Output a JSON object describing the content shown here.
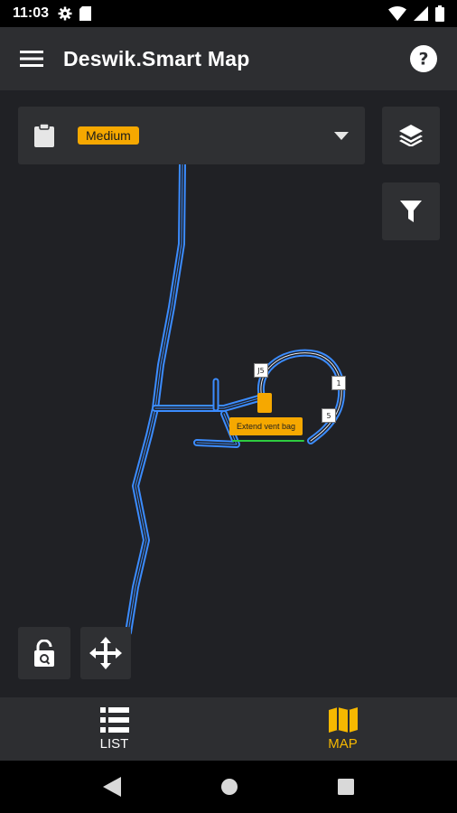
{
  "status_bar": {
    "time": "11:03"
  },
  "app_bar": {
    "title": "Deswik.Smart Map"
  },
  "filter_selector": {
    "selected_value": "Medium"
  },
  "map": {
    "task_label": "Extend vent bag",
    "point_tags": [
      "J5",
      "1",
      "5"
    ]
  },
  "bottom_nav": {
    "items": [
      {
        "label": "LIST",
        "icon": "list-icon",
        "active": false
      },
      {
        "label": "MAP",
        "icon": "map-icon",
        "active": true
      }
    ]
  },
  "colors": {
    "accent": "#f6a800",
    "tunnel": "#3b8cff",
    "background": "#202125"
  }
}
